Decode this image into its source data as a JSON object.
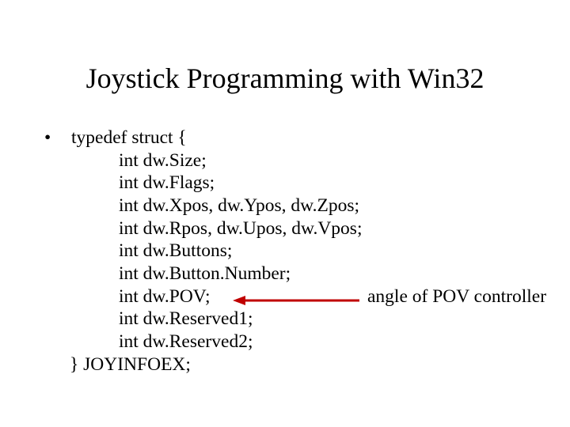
{
  "title": "Joystick Programming with Win32",
  "bullet_marker": "•",
  "struct": {
    "open": "typedef struct {",
    "lines": [
      "int dw.Size;",
      "int dw.Flags;",
      "int dw.Xpos, dw.Ypos, dw.Zpos;",
      "int dw.Rpos, dw.Upos, dw.Vpos;",
      "int dw.Buttons;",
      "int dw.Button.Number;",
      "int dw.POV;",
      "int dw.Reserved1;",
      "int dw.Reserved2;"
    ],
    "close": "} JOYINFOEX;"
  },
  "annotation": "angle of POV controller",
  "arrow_color": "#c00000"
}
